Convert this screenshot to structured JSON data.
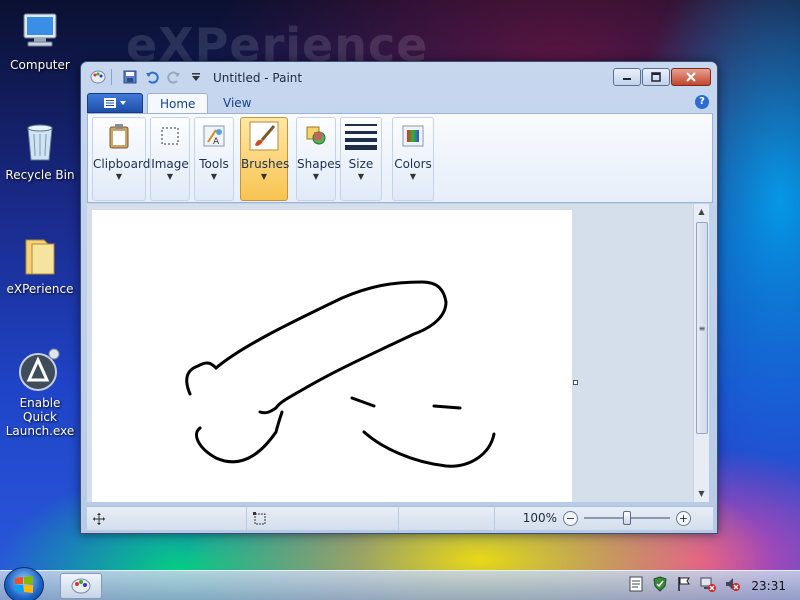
{
  "desktop": {
    "watermark": "eXPerience",
    "icons": [
      {
        "label": "Computer"
      },
      {
        "label": "Recycle Bin"
      },
      {
        "label": "eXPerience"
      },
      {
        "label": "Enable Quick Launch.exe"
      }
    ]
  },
  "window": {
    "title": "Untitled - Paint",
    "tabs": [
      {
        "label": "Home"
      },
      {
        "label": "View"
      }
    ],
    "help_glyph": "?",
    "ribbon": {
      "groups": [
        {
          "label": "Clipboard",
          "icon": "clipboard-icon"
        },
        {
          "label": "Image",
          "icon": "image-select-icon"
        },
        {
          "label": "Tools",
          "icon": "tools-icon"
        },
        {
          "label": "Brushes",
          "icon": "brush-icon",
          "active": true
        },
        {
          "label": "Shapes",
          "icon": "shapes-icon"
        },
        {
          "label": "Size",
          "icon": "size-icon"
        },
        {
          "label": "Colors",
          "icon": "colors-icon"
        }
      ]
    },
    "statusbar": {
      "zoom_label": "100%",
      "zoom_level_fraction": 0.5
    }
  },
  "taskbar": {
    "clock": "23:31"
  },
  "colors": {
    "accent": "#f8c452",
    "title_text": "#1e2a3a",
    "canvas": "#ffffff"
  }
}
